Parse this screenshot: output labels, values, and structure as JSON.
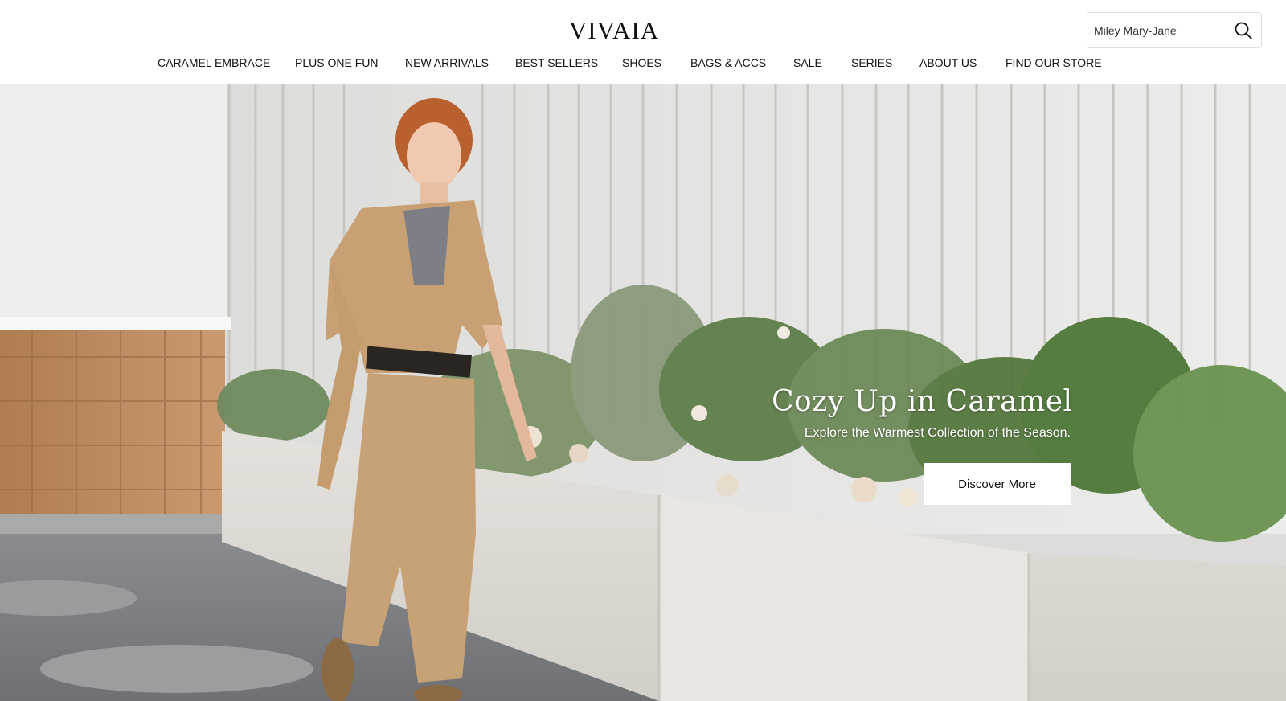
{
  "brand": {
    "logo_text": "VIVAIA"
  },
  "search": {
    "placeholder": "Miley Mary-Jane",
    "icon": "search-icon"
  },
  "nav": {
    "items": [
      {
        "label": "CARAMEL EMBRACE"
      },
      {
        "label": "PLUS ONE FUN"
      },
      {
        "label": "NEW ARRIVALS"
      },
      {
        "label": "BEST SELLERS"
      },
      {
        "label": "SHOES"
      },
      {
        "label": "BAGS & ACCS"
      },
      {
        "label": "SALE"
      },
      {
        "label": "SERIES"
      },
      {
        "label": "ABOUT US"
      },
      {
        "label": "FIND OUR STORE"
      }
    ]
  },
  "hero": {
    "title": "Cozy Up in Caramel",
    "subtitle": "Explore the Warmest Collection of the Season.",
    "cta_label": "Discover More"
  },
  "colors": {
    "text": "#111111",
    "background": "#ffffff",
    "caramel": "#c9a37a",
    "cta_background": "#ffffff"
  }
}
